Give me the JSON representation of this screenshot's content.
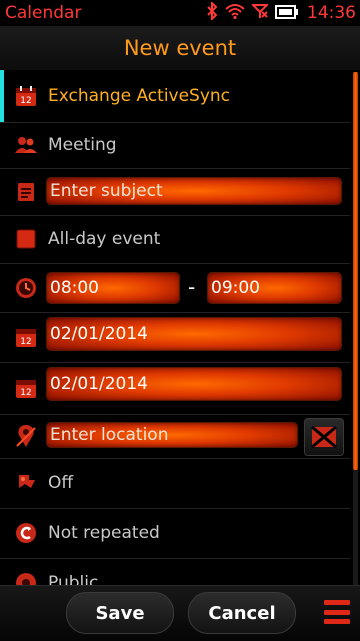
{
  "status": {
    "app_name": "Calendar",
    "time": "14:36",
    "icons": [
      "bluetooth-icon",
      "wifi-icon",
      "no-signal-icon",
      "battery-icon"
    ]
  },
  "header": {
    "title": "New event"
  },
  "form": {
    "calendar_account": "Exchange ActiveSync",
    "event_type": "Meeting",
    "subject_placeholder": "Enter subject",
    "all_day_label": "All-day event",
    "start_time": "08:00",
    "time_separator": "-",
    "end_time": "09:00",
    "start_date": "02/01/2014",
    "end_date": "02/01/2014",
    "location_placeholder": "Enter location",
    "alarm": "Off",
    "repeat": "Not repeated",
    "privacy": "Public"
  },
  "toolbar": {
    "save_label": "Save",
    "cancel_label": "Cancel"
  },
  "colors": {
    "accent_orange": "#ff9a1a",
    "status_red": "#ff3838",
    "field_orange": "#ff6a00",
    "selection_cyan": "#20e0e0"
  }
}
